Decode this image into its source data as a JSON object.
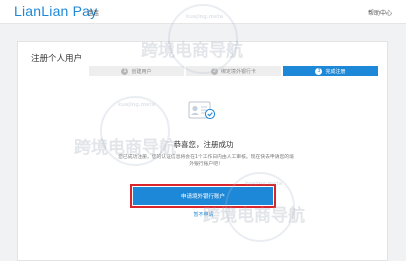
{
  "header": {
    "logo": "LianLian Pay",
    "logo_sub": "连连",
    "help": "帮助中心"
  },
  "page": {
    "title": "注册个人用户"
  },
  "steps": [
    {
      "number": "1",
      "label": "创建用户",
      "active": false
    },
    {
      "number": "2",
      "label": "绑定境外银行卡",
      "active": false
    },
    {
      "number": "3",
      "label": "完成注册",
      "active": true
    }
  ],
  "result": {
    "icon": "id-card-check-icon",
    "title": "恭喜您，注册成功",
    "description": "您已成功注册，您的认证信息将会在1个工作日内由人工审核。现在快去申请您的境外银行账户吧！",
    "primary_button": "申请境外银行账户",
    "secondary_link": "暂不申请"
  },
  "watermark": {
    "text": "跨境电商导航",
    "sub": "kuajing.meta"
  },
  "colors": {
    "accent": "#1e88d8",
    "highlight": "#d9252b",
    "background": "#f1f2f4"
  }
}
